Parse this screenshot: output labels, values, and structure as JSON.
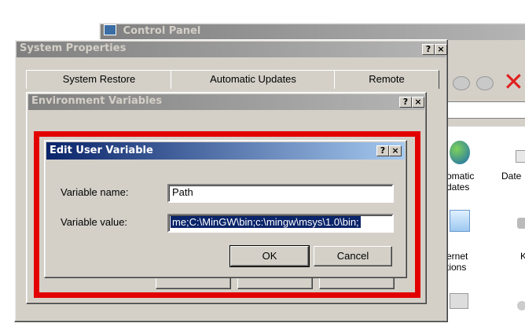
{
  "control_panel": {
    "title": "Control Panel",
    "icons": [
      {
        "label": "omatic\ndates"
      },
      {
        "label": "Date"
      },
      {
        "label": "ernet\ntions"
      },
      {
        "label": "Ke"
      }
    ]
  },
  "system_properties": {
    "title": "System Properties",
    "help": "?",
    "close": "×",
    "tabs": [
      "System Restore",
      "Automatic Updates",
      "Remote"
    ]
  },
  "env_vars": {
    "title": "Environment Variables",
    "help": "?",
    "close": "×"
  },
  "edit_var": {
    "title": "Edit User Variable",
    "help": "?",
    "close": "×",
    "name_label": "Variable name:",
    "value_label": "Variable value:",
    "name_value": "Path",
    "value_value": "me;C:\\MinGW\\bin;c:\\mingw\\msys\\1.0\\bin;",
    "ok_label": "OK",
    "cancel_label": "Cancel"
  },
  "colors": {
    "highlight_box": "#e20000",
    "active_title": "#0a246a",
    "selection": "#0a246a",
    "desktop_bg": "#3a6ea5"
  }
}
